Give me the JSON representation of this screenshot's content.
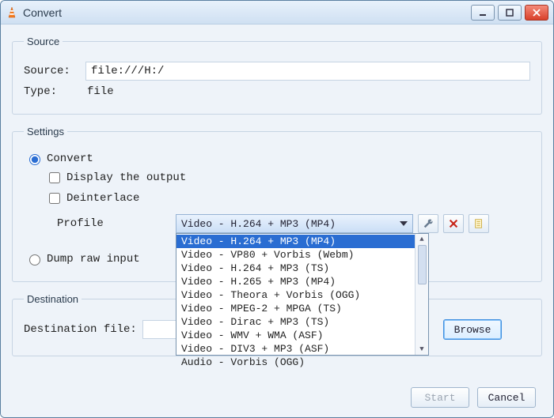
{
  "window": {
    "title": "Convert"
  },
  "source_group": {
    "legend": "Source",
    "source_label": "Source:",
    "source_value": "file:///H:/",
    "type_label": "Type:",
    "type_value": "file"
  },
  "settings_group": {
    "legend": "Settings",
    "convert_label": "Convert",
    "convert_checked": true,
    "display_output_label": "Display the output",
    "display_output_checked": false,
    "deinterlace_label": "Deinterlace",
    "deinterlace_checked": false,
    "profile_label": "Profile",
    "profile_selected": "Video - H.264 + MP3 (MP4)",
    "profile_options": [
      "Video - H.264 + MP3 (MP4)",
      "Video - VP80 + Vorbis (Webm)",
      "Video - H.264 + MP3 (TS)",
      "Video - H.265 + MP3 (MP4)",
      "Video - Theora + Vorbis (OGG)",
      "Video - MPEG-2 + MPGA (TS)",
      "Video - Dirac + MP3 (TS)",
      "Video - WMV + WMA (ASF)",
      "Video - DIV3 + MP3 (ASF)",
      "Audio - Vorbis (OGG)"
    ],
    "profile_selected_index": 0,
    "dump_raw_label": "Dump raw input",
    "dump_raw_checked": false
  },
  "destination_group": {
    "legend": "Destination",
    "file_label": "Destination file:",
    "file_value": "",
    "browse_label": "Browse"
  },
  "footer": {
    "start_label": "Start",
    "cancel_label": "Cancel"
  }
}
